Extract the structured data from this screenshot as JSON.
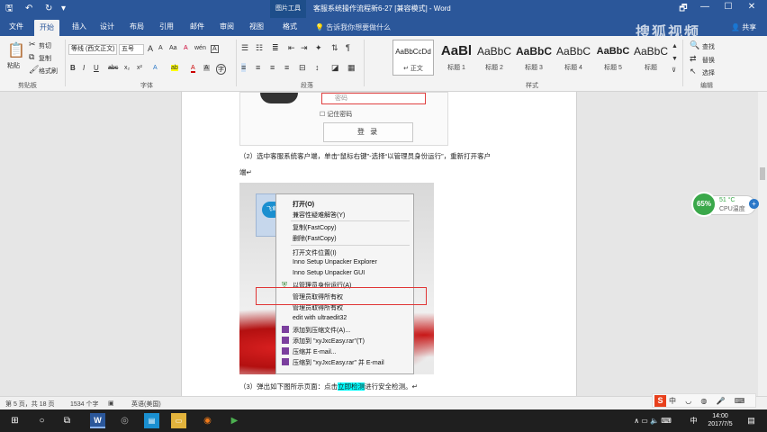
{
  "titlebar": {
    "title": "客服系统操作流程新6-27 [兼容模式] - Word",
    "context_tab": "图片工具",
    "qa_save": "🖫",
    "qa_undo": "↶",
    "qa_redo": "↻",
    "qa_more": "▾",
    "win_restore": "🗗",
    "win_min": "—",
    "win_max": "☐",
    "win_close": "✕"
  },
  "tabs": {
    "items": [
      {
        "label": "文件"
      },
      {
        "label": "开始"
      },
      {
        "label": "插入"
      },
      {
        "label": "设计"
      },
      {
        "label": "布局"
      },
      {
        "label": "引用"
      },
      {
        "label": "邮件"
      },
      {
        "label": "审阅"
      },
      {
        "label": "视图"
      },
      {
        "label": "格式"
      }
    ],
    "tell_me": "告诉我你想要做什么",
    "share": "共享"
  },
  "ribbon": {
    "clipboard": {
      "paste": "粘贴",
      "cut": "剪切",
      "copy": "复制",
      "format_painter": "格式刷",
      "group": "剪贴板"
    },
    "font": {
      "font_name": "等线 (西文正文)",
      "font_size": "五号",
      "bold": "B",
      "italic": "I",
      "underline": "U",
      "strike": "abc",
      "sub": "x₂",
      "sup": "x²",
      "grow": "A",
      "shrink": "A",
      "case": "Aa",
      "clear": "A",
      "wen": "wén",
      "char_border": "A",
      "highlight": "ab",
      "font_color": "A",
      "char_shade": "A",
      "enclose": "字",
      "group": "字体"
    },
    "paragraph": {
      "group": "段落"
    },
    "styles": {
      "items": [
        {
          "sample": "AaBbCcDd",
          "name": "正文"
        },
        {
          "sample": "AaBl",
          "name": "标题 1"
        },
        {
          "sample": "AaBbC",
          "name": "标题 2"
        },
        {
          "sample": "AaBbC",
          "name": "标题 3"
        },
        {
          "sample": "AaBbC",
          "name": "标题 4"
        },
        {
          "sample": "AaBbC",
          "name": "标题 5"
        },
        {
          "sample": "AaBbC",
          "name": "标题"
        }
      ],
      "group": "样式"
    },
    "editing": {
      "find": "查找",
      "replace": "替换",
      "select": "选择",
      "group": "编辑"
    }
  },
  "watermark": "搜狐视频",
  "document": {
    "login_image": {
      "password_placeholder": "密码",
      "remember": "记住密码",
      "login_button": "登 录"
    },
    "step2_line1": "（2）选中客服系统客户端，单击“鼠标右键”-选择“以管理员身份运行”，重新打开客户",
    "step2_line2": "端↵",
    "context_menu": {
      "app_icon_label": "飞鱼",
      "items": [
        {
          "label": "打开(O)",
          "bold": true
        },
        {
          "label": "兼容性疑难解答(Y)"
        },
        {
          "label": "复制(FastCopy)"
        },
        {
          "label": "删除(FastCopy)"
        },
        {
          "label": "打开文件位置(I)"
        },
        {
          "label": "Inno Setup Unpacker Explorer"
        },
        {
          "label": "Inno Setup Unpacker GUI"
        },
        {
          "label": "以管理员身份运行(A)"
        },
        {
          "label": "管理员取得所有权"
        },
        {
          "label": "管理员取得所有权"
        },
        {
          "label": "edit with ultraedit32"
        },
        {
          "label": "添加到压缩文件(A)..."
        },
        {
          "label": "添加到 \"xyJxcEasy.rar\"(T)"
        },
        {
          "label": "压缩并 E-mail..."
        },
        {
          "label": "压缩到 \"xyJxcEasy.rar\" 并 E-mail"
        }
      ]
    },
    "step3_pre": "（3）弹出如下图所示页面：点击",
    "step3_highlight": "立即检测",
    "step3_post": "进行安全检测。↵"
  },
  "cpu_widget": {
    "percent": "65%",
    "temp": "51 °C",
    "label": "CPU温度",
    "plus": "+"
  },
  "status": {
    "page": "第 5 页，共 18 页",
    "words": "1534 个字",
    "lang": "英语(美国)"
  },
  "ime": {
    "logo": "S",
    "text": "中 ◡ ◍ 🎤 ⌨"
  },
  "taskbar": {
    "start": "⊞",
    "search": "○",
    "taskview": "⧉",
    "time": "14:00",
    "date": "2017/7/5",
    "lang": "中",
    "tray": "∧ ▭ 🔈 ⌨",
    "notify": "▤"
  },
  "colors": {
    "accent": "#2b579a",
    "highlight": "#00ffff",
    "alert": "#e03535",
    "cpu": "#3aa84a"
  }
}
